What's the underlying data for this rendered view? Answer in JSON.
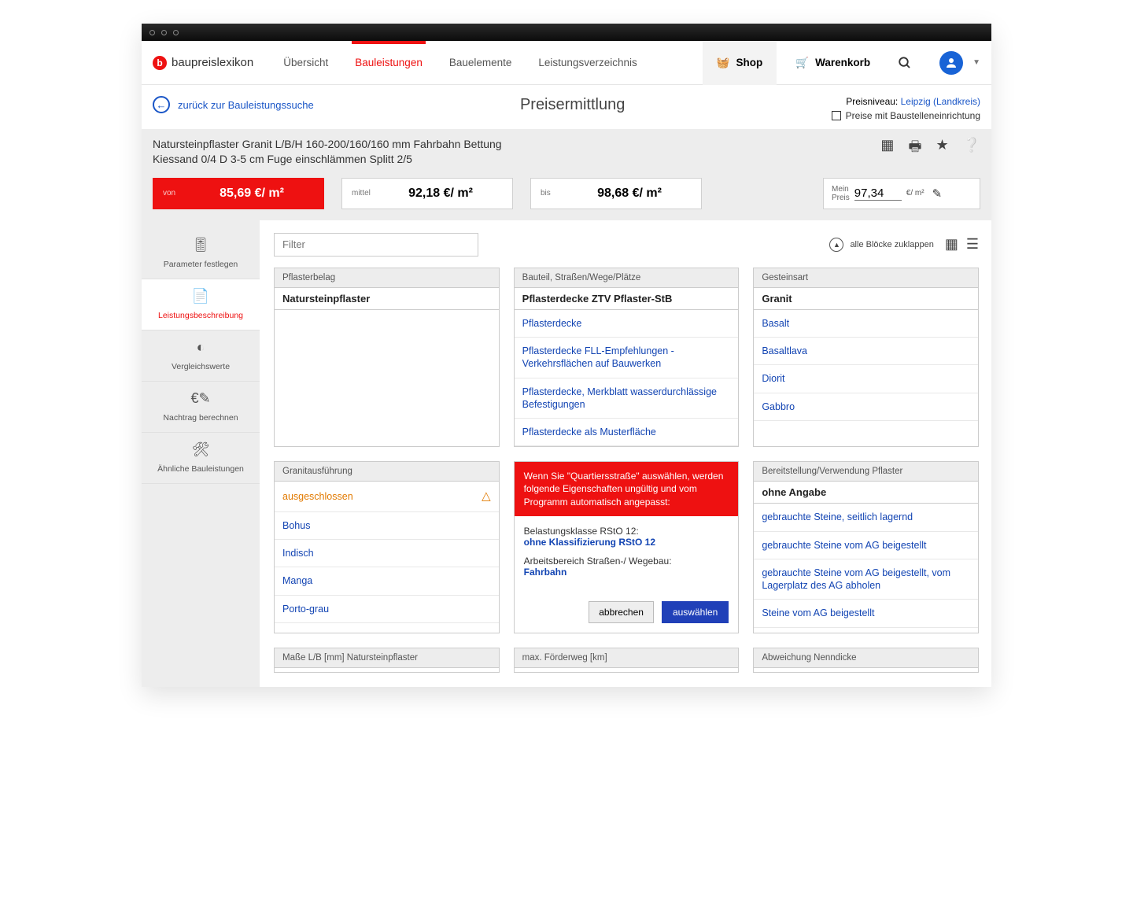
{
  "logo_text": "baupreislexikon",
  "nav": {
    "uebersicht": "Übersicht",
    "bauleistungen": "Bauleistungen",
    "bauelemente": "Bauelemente",
    "lv": "Leistungsverzeichnis"
  },
  "shop": "Shop",
  "cart": "Warenkorb",
  "back_link": "zurück zur Bauleistungssuche",
  "page_title": "Preisermittlung",
  "price_level_label": "Preisniveau:",
  "price_level_value": "Leipzig (Landkreis)",
  "price_mode": "Preise mit Baustelleneinrichtung",
  "description_l1": "Natursteinpflaster Granit L/B/H 160-200/160/160 mm Fahrbahn Bettung",
  "description_l2": "Kiessand 0/4 D 3-5 cm Fuge einschlämmen Splitt 2/5",
  "price_von_label": "von",
  "price_von": "85,69 €/ m²",
  "price_mittel_label": "mittel",
  "price_mittel": "92,18 €/ m²",
  "price_bis_label": "bis",
  "price_bis": "98,68 €/ m²",
  "my_price_label": "Mein\nPreis",
  "my_price_value": "97,34",
  "my_price_unit": "€/ m²",
  "side": {
    "parameter": "Parameter festlegen",
    "leistung": "Leistungsbeschreibung",
    "vergleich": "Vergleichswerte",
    "nachtrag": "Nachtrag berechnen",
    "aehnlich": "Ähnliche Bauleistungen"
  },
  "filter_placeholder": "Filter",
  "collapse_all": "alle Blöcke zuklappen",
  "blocks": {
    "pflasterbelag": {
      "title": "Pflasterbelag",
      "selected": "Natursteinpflaster"
    },
    "bauteil": {
      "title": "Bauteil, Straßen/Wege/Plätze",
      "selected": "Pflasterdecke ZTV Pflaster-StB",
      "opts": [
        "Pflasterdecke",
        "Pflasterdecke FLL-Empfehlungen - Verkehrsflächen auf Bauwerken",
        "Pflasterdecke, Merkblatt wasserdurchlässige Befestigungen",
        "Pflasterdecke als Musterfläche"
      ]
    },
    "gesteinsart": {
      "title": "Gesteinsart",
      "selected": "Granit",
      "opts": [
        "Basalt",
        "Basaltlava",
        "Diorit",
        "Gabbro"
      ]
    },
    "granit": {
      "title": "Granitausführung",
      "excluded": "ausgeschlossen",
      "opts": [
        "Bohus",
        "Indisch",
        "Manga",
        "Porto-grau"
      ]
    },
    "bereitstellung": {
      "title": "Bereitstellung/Verwendung Pflaster",
      "selected": "ohne Angabe",
      "opts": [
        "gebrauchte Steine, seitlich lagernd",
        "gebrauchte Steine vom AG beigestellt",
        "gebrauchte Steine vom AG beigestellt, vom Lagerplatz des AG abholen",
        "Steine vom AG beigestellt"
      ]
    },
    "masse": {
      "title": "Maße L/B [mm] Natursteinpflaster"
    },
    "foerderweg": {
      "title": "max. Förderweg [km]"
    },
    "abweichung": {
      "title": "Abweichung Nenndicke"
    }
  },
  "warn": {
    "head": "Wenn Sie \"Quartiersstraße\" auswählen, werden folgende Eigenschaften ungültig und vom Programm automatisch angepasst:",
    "k1": "Belastungsklasse RStO 12:",
    "v1": "ohne Klassifizierung RStO 12",
    "k2": "Arbeitsbereich Straßen-/ Wegebau:",
    "v2": "Fahrbahn",
    "cancel": "abbrechen",
    "ok": "auswählen"
  }
}
